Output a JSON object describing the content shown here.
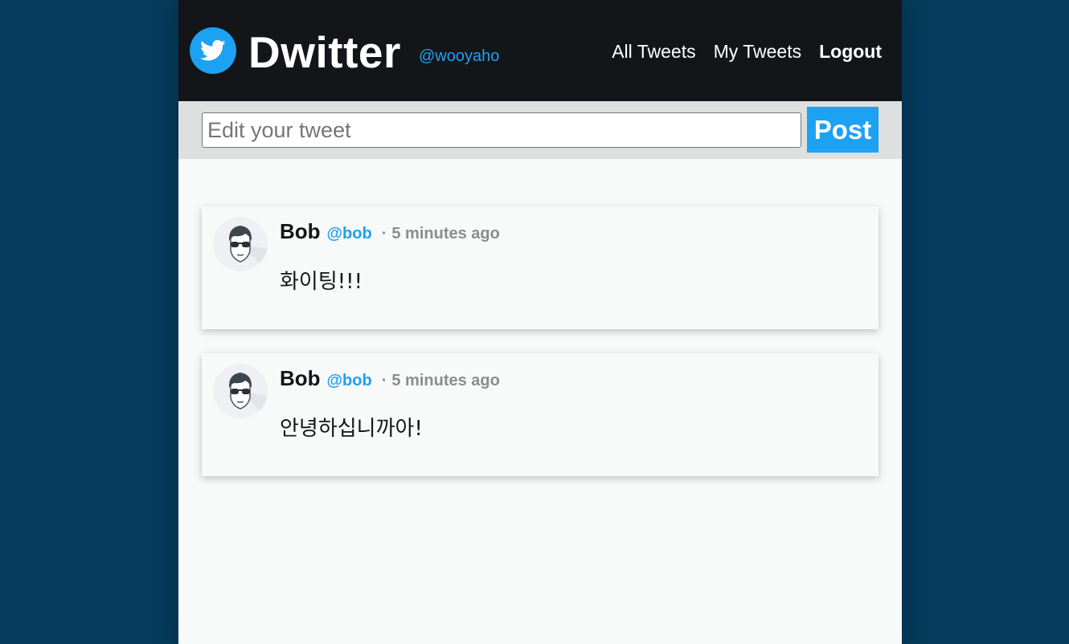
{
  "header": {
    "brand_title": "Dwitter",
    "brand_handle": "@wooyaho",
    "nav": {
      "all_tweets": "All Tweets",
      "my_tweets": "My Tweets",
      "logout": "Logout"
    }
  },
  "editor": {
    "placeholder": "Edit your tweet",
    "value": "",
    "post_label": "Post"
  },
  "tweets": [
    {
      "name": "Bob",
      "handle": "@bob",
      "separator": "·",
      "time": "5 minutes ago",
      "text": "화이팅!!!"
    },
    {
      "name": "Bob",
      "handle": "@bob",
      "separator": "·",
      "time": "5 minutes ago",
      "text": "안녕하십니까아!"
    }
  ],
  "colors": {
    "background": "#053b5c",
    "header": "#141519",
    "accent": "#1da1f2",
    "editor_bar": "#dedfdf",
    "muted_text": "#8a8c8f"
  }
}
